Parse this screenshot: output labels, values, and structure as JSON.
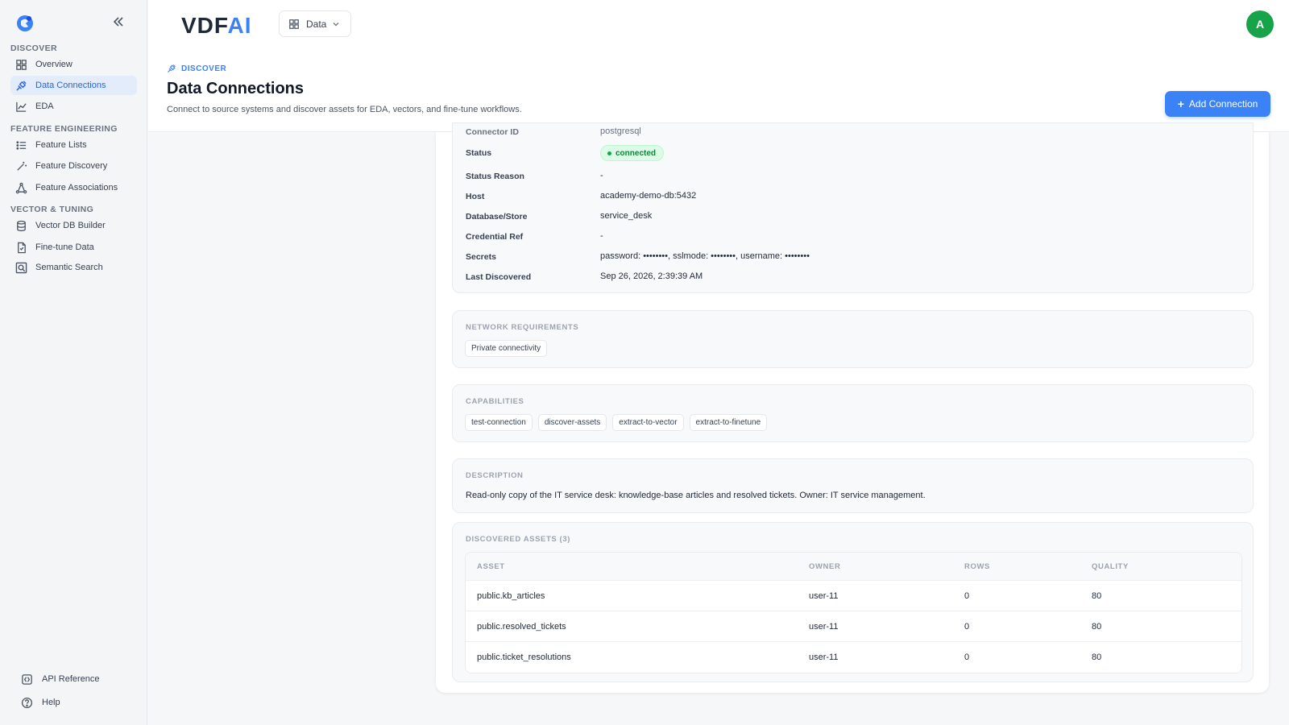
{
  "sidebar": {
    "sections": [
      {
        "label": "DISCOVER",
        "items": [
          {
            "label": "Overview",
            "icon": "grid-icon"
          },
          {
            "label": "Data Connections",
            "icon": "plug-icon",
            "active": true
          },
          {
            "label": "EDA",
            "icon": "chart-icon"
          }
        ]
      },
      {
        "label": "FEATURE ENGINEERING",
        "items": [
          {
            "label": "Feature Lists",
            "icon": "list-icon"
          },
          {
            "label": "Feature Discovery",
            "icon": "wand-icon"
          },
          {
            "label": "Feature Associations",
            "icon": "network-icon"
          }
        ]
      },
      {
        "label": "VECTOR & TUNING",
        "items": [
          {
            "label": "Vector DB Builder",
            "icon": "database-icon"
          },
          {
            "label": "Fine-tune Data",
            "icon": "file-icon"
          },
          {
            "label": "Semantic Search",
            "icon": "search-icon"
          }
        ]
      }
    ],
    "footer": [
      {
        "label": "API Reference",
        "icon": "api-icon"
      },
      {
        "label": "Help",
        "icon": "help-icon"
      }
    ]
  },
  "header": {
    "brand_main": "VDF",
    "brand_accent": "AI",
    "data_menu": "Data",
    "avatar_initial": "A"
  },
  "page": {
    "breadcrumb": "DISCOVER",
    "title": "Data Connections",
    "subtitle": "Connect to source systems and discover assets for EDA, vectors, and fine-tune workflows.",
    "add_button": "Add Connection"
  },
  "details": {
    "cut_label": "Connector ID",
    "cut_value": "postgresql",
    "status_label": "Status",
    "status_value": "connected",
    "rows": [
      {
        "label": "Status Reason",
        "value": "-"
      },
      {
        "label": "Host",
        "value": "academy-demo-db:5432"
      },
      {
        "label": "Database/Store",
        "value": "service_desk"
      },
      {
        "label": "Credential Ref",
        "value": "-"
      },
      {
        "label": "Secrets",
        "value": "password: ••••••••, sslmode: ••••••••, username: ••••••••"
      },
      {
        "label": "Last Discovered",
        "value": "Sep 26, 2026, 2:39:39 AM"
      }
    ]
  },
  "network": {
    "title": "NETWORK REQUIREMENTS",
    "chips": [
      "Private connectivity"
    ]
  },
  "capabilities": {
    "title": "CAPABILITIES",
    "chips": [
      "test-connection",
      "discover-assets",
      "extract-to-vector",
      "extract-to-finetune"
    ]
  },
  "description": {
    "title": "DESCRIPTION",
    "text": "Read-only copy of the IT service desk: knowledge-base articles and resolved tickets. Owner: IT service management."
  },
  "assets": {
    "title": "DISCOVERED ASSETS (3)",
    "columns": [
      "ASSET",
      "OWNER",
      "ROWS",
      "QUALITY"
    ],
    "rows": [
      {
        "asset": "public.kb_articles",
        "owner": "user-11",
        "rows": "0",
        "quality": "80"
      },
      {
        "asset": "public.resolved_tickets",
        "owner": "user-11",
        "rows": "0",
        "quality": "80"
      },
      {
        "asset": "public.ticket_resolutions",
        "owner": "user-11",
        "rows": "0",
        "quality": "80"
      }
    ]
  },
  "colors": {
    "accent": "#3b82f6",
    "active_bg": "#e3ecfb",
    "success": "#16a34a"
  }
}
